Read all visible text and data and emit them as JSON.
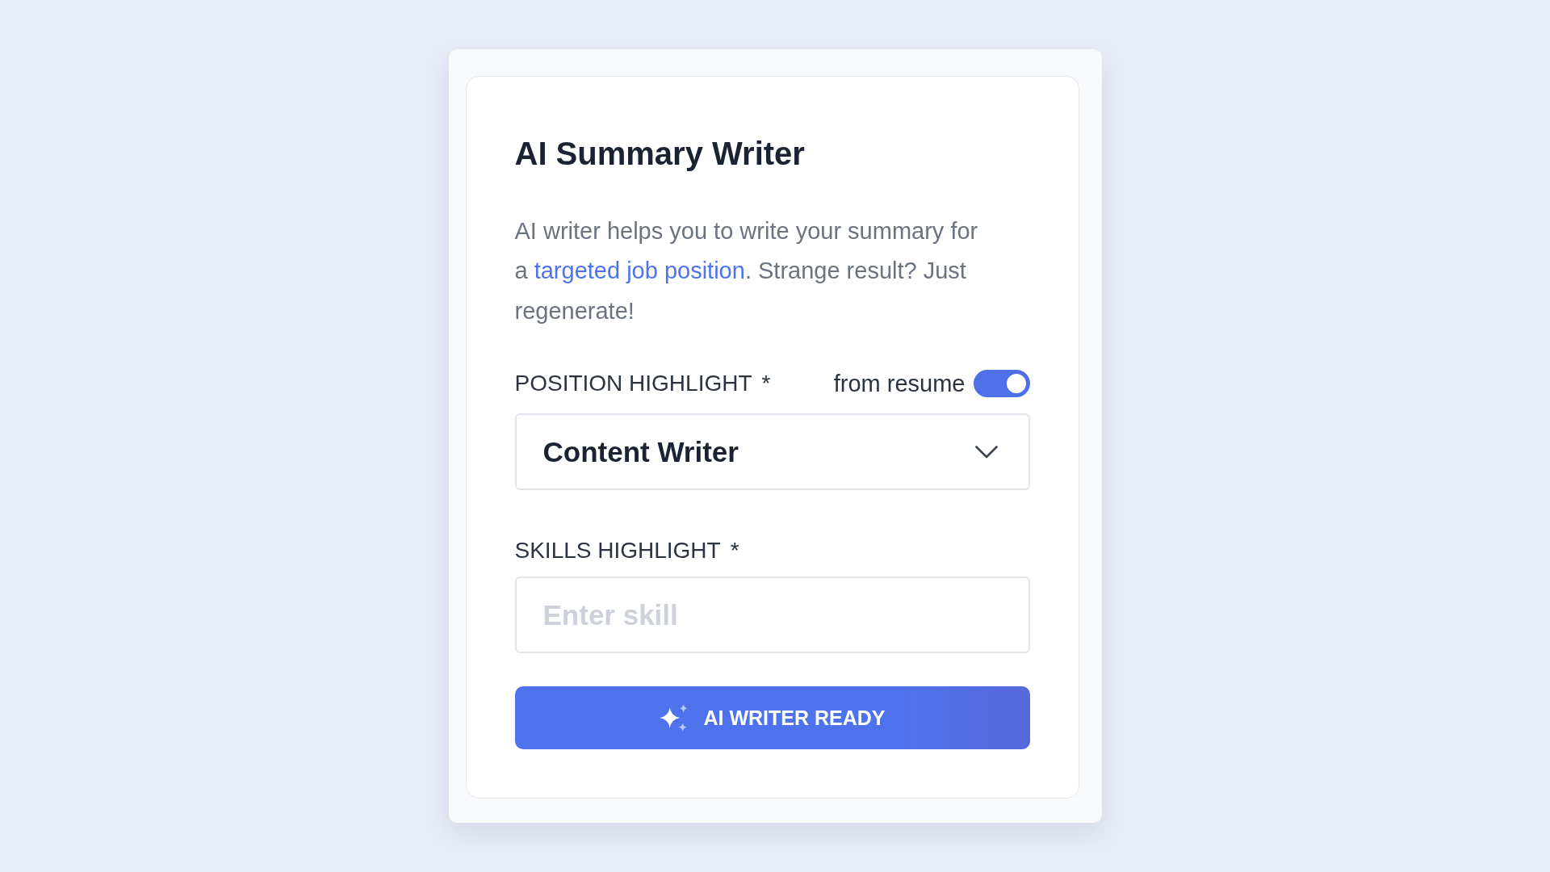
{
  "card": {
    "title": "AI Summary Writer",
    "description": {
      "text_before": "AI writer helps you to write your summary for a ",
      "link": "targeted job position",
      "text_after": ". Strange result? Just regenerate!"
    },
    "position_field": {
      "label": "POSITION HIGHLIGHT",
      "required_mark": "*",
      "toggle": {
        "label": "from resume",
        "on": true
      },
      "value": "Content Writer"
    },
    "skills_field": {
      "label": "SKILLS HIGHLIGHT",
      "required_mark": "*",
      "placeholder": "Enter skill"
    },
    "button": {
      "label": "AI WRITER READY"
    }
  }
}
